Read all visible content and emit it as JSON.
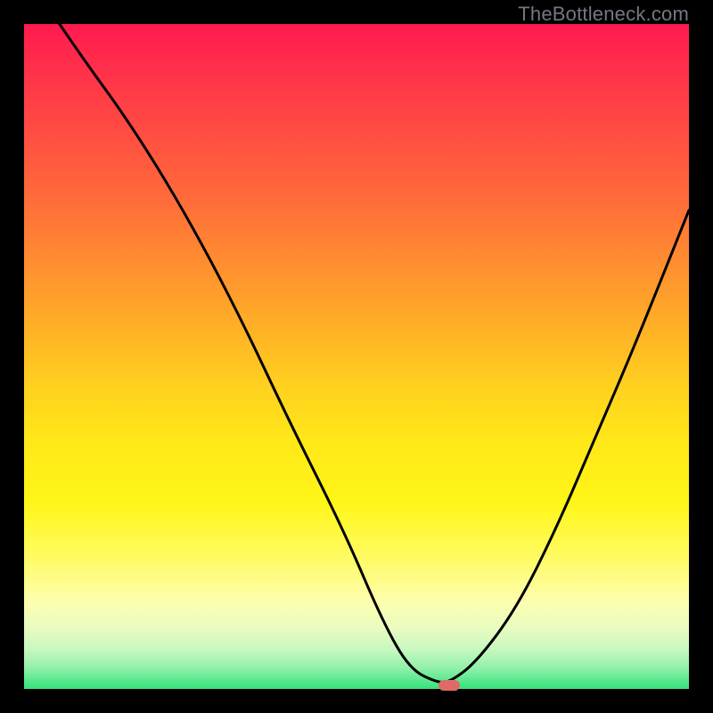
{
  "attribution": "TheBottleneck.com",
  "colors": {
    "page_bg": "#000000",
    "curve_stroke": "#000000",
    "marker_fill": "#e06a66",
    "attribution_text": "#777680",
    "gradient_stops": [
      "#ff1a4f",
      "#ff3a48",
      "#ff6a3a",
      "#ffa32a",
      "#ffd21e",
      "#ffe818",
      "#fff618",
      "#fffb60",
      "#fdfeb0",
      "#e8fbc0",
      "#c8f8c0",
      "#8ef0a8",
      "#34e27a"
    ]
  },
  "chart_data": {
    "type": "line",
    "title": "",
    "xlabel": "",
    "ylabel": "",
    "xlim": [
      0,
      100
    ],
    "ylim": [
      0,
      100
    ],
    "grid": false,
    "legend": false,
    "series": [
      {
        "name": "bottleneck-curve",
        "x": [
          0,
          8,
          16,
          24,
          32,
          40,
          48,
          54,
          58,
          62,
          64,
          68,
          74,
          80,
          86,
          92,
          100
        ],
        "y": [
          108,
          96,
          85,
          72,
          57,
          40,
          24,
          10,
          3,
          1,
          1,
          4,
          12,
          24,
          38,
          52,
          72
        ]
      }
    ],
    "flat_segment": {
      "x_start": 60,
      "x_end": 66,
      "y": 1
    },
    "marker": {
      "x": 64,
      "y": 0.5
    }
  }
}
